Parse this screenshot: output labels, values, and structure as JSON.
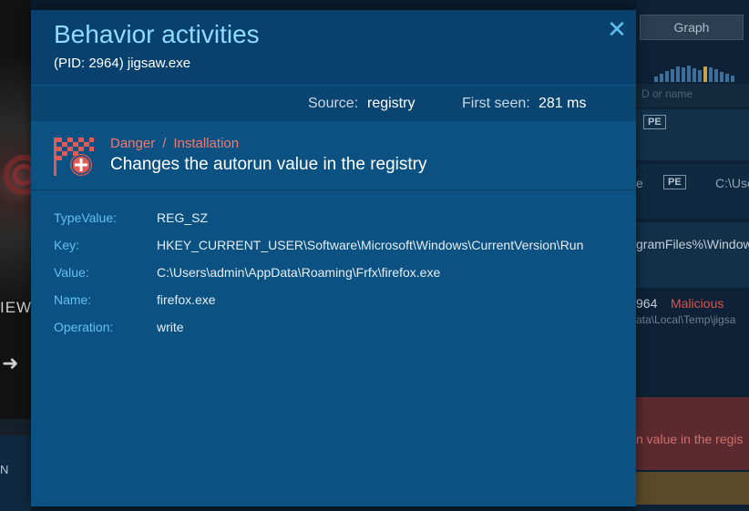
{
  "background": {
    "left_text": "IEW",
    "left_bottom_text": "N",
    "graph_button": "Graph",
    "search_placeholder": "D or name",
    "pe_badge_1": "PE",
    "pe_badge_2": "PE",
    "row_fragment_1": "e",
    "row_fragment_2": "C:\\Use",
    "row_fragment_3": "gramFiles%\\Window",
    "pid_fragment": "964",
    "verdict": "Malicious",
    "path_fragment": "ata\\Local\\Temp\\jigsa",
    "danger_fragment": "n value in the regis"
  },
  "modal": {
    "title": "Behavior activities",
    "subtitle": "(PID: 2964) jigsaw.exe",
    "close_glyph": "✕",
    "source_label": "Source:",
    "source_value": "registry",
    "first_seen_label": "First seen:",
    "first_seen_value": "281 ms",
    "event": {
      "severity": "Danger",
      "separator": "/",
      "category": "Installation",
      "description": "Changes the autorun value in the registry",
      "icon": "checkered-flag-plus-icon"
    },
    "details": [
      {
        "key": "TypeValue:",
        "value": "REG_SZ"
      },
      {
        "key": "Key:",
        "value": "HKEY_CURRENT_USER\\Software\\Microsoft\\Windows\\CurrentVersion\\Run"
      },
      {
        "key": "Value:",
        "value": "C:\\Users\\admin\\AppData\\Roaming\\Frfx\\firefox.exe"
      },
      {
        "key": "Name:",
        "value": "firefox.exe"
      },
      {
        "key": "Operation:",
        "value": "write"
      }
    ]
  },
  "colors": {
    "modal_bg": "#0b5182",
    "header_bg": "#08416d",
    "title": "#8fdcff",
    "danger": "#f07a72",
    "detail_key": "#64c0f0"
  }
}
